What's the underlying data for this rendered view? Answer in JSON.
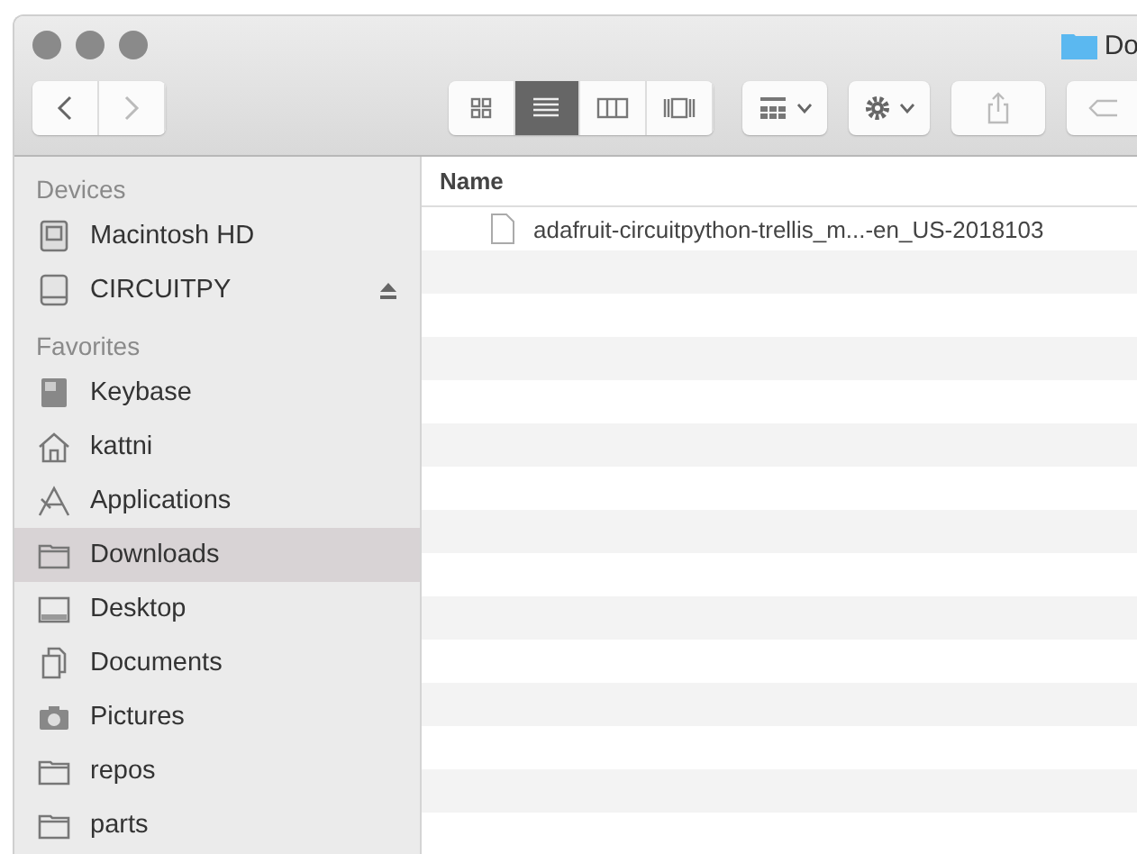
{
  "window": {
    "title": "Do"
  },
  "toolbar": {
    "view_modes": [
      {
        "kind": "icons",
        "selected": false
      },
      {
        "kind": "list",
        "selected": true
      },
      {
        "kind": "columns",
        "selected": false
      },
      {
        "kind": "coverflow",
        "selected": false
      }
    ]
  },
  "sidebar": {
    "sections": [
      {
        "heading": "Devices",
        "items": [
          {
            "label": "Macintosh HD",
            "kind": "disk",
            "selected": false,
            "ejectable": false
          },
          {
            "label": "CIRCUITPY",
            "kind": "drive",
            "selected": false,
            "ejectable": true
          }
        ]
      },
      {
        "heading": "Favorites",
        "items": [
          {
            "label": "Keybase",
            "kind": "keybase",
            "selected": false,
            "ejectable": false
          },
          {
            "label": "kattni",
            "kind": "home",
            "selected": false,
            "ejectable": false
          },
          {
            "label": "Applications",
            "kind": "apps",
            "selected": false,
            "ejectable": false
          },
          {
            "label": "Downloads",
            "kind": "folder",
            "selected": true,
            "ejectable": false
          },
          {
            "label": "Desktop",
            "kind": "desktop",
            "selected": false,
            "ejectable": false
          },
          {
            "label": "Documents",
            "kind": "documents",
            "selected": false,
            "ejectable": false
          },
          {
            "label": "Pictures",
            "kind": "camera",
            "selected": false,
            "ejectable": false
          },
          {
            "label": "repos",
            "kind": "folder",
            "selected": false,
            "ejectable": false
          },
          {
            "label": "parts",
            "kind": "folder",
            "selected": false,
            "ejectable": false
          }
        ]
      }
    ]
  },
  "table": {
    "columns": [
      "Name"
    ],
    "rows": [
      {
        "name": "adafruit-circuitpython-trellis_m...-en_US-2018103"
      }
    ]
  }
}
